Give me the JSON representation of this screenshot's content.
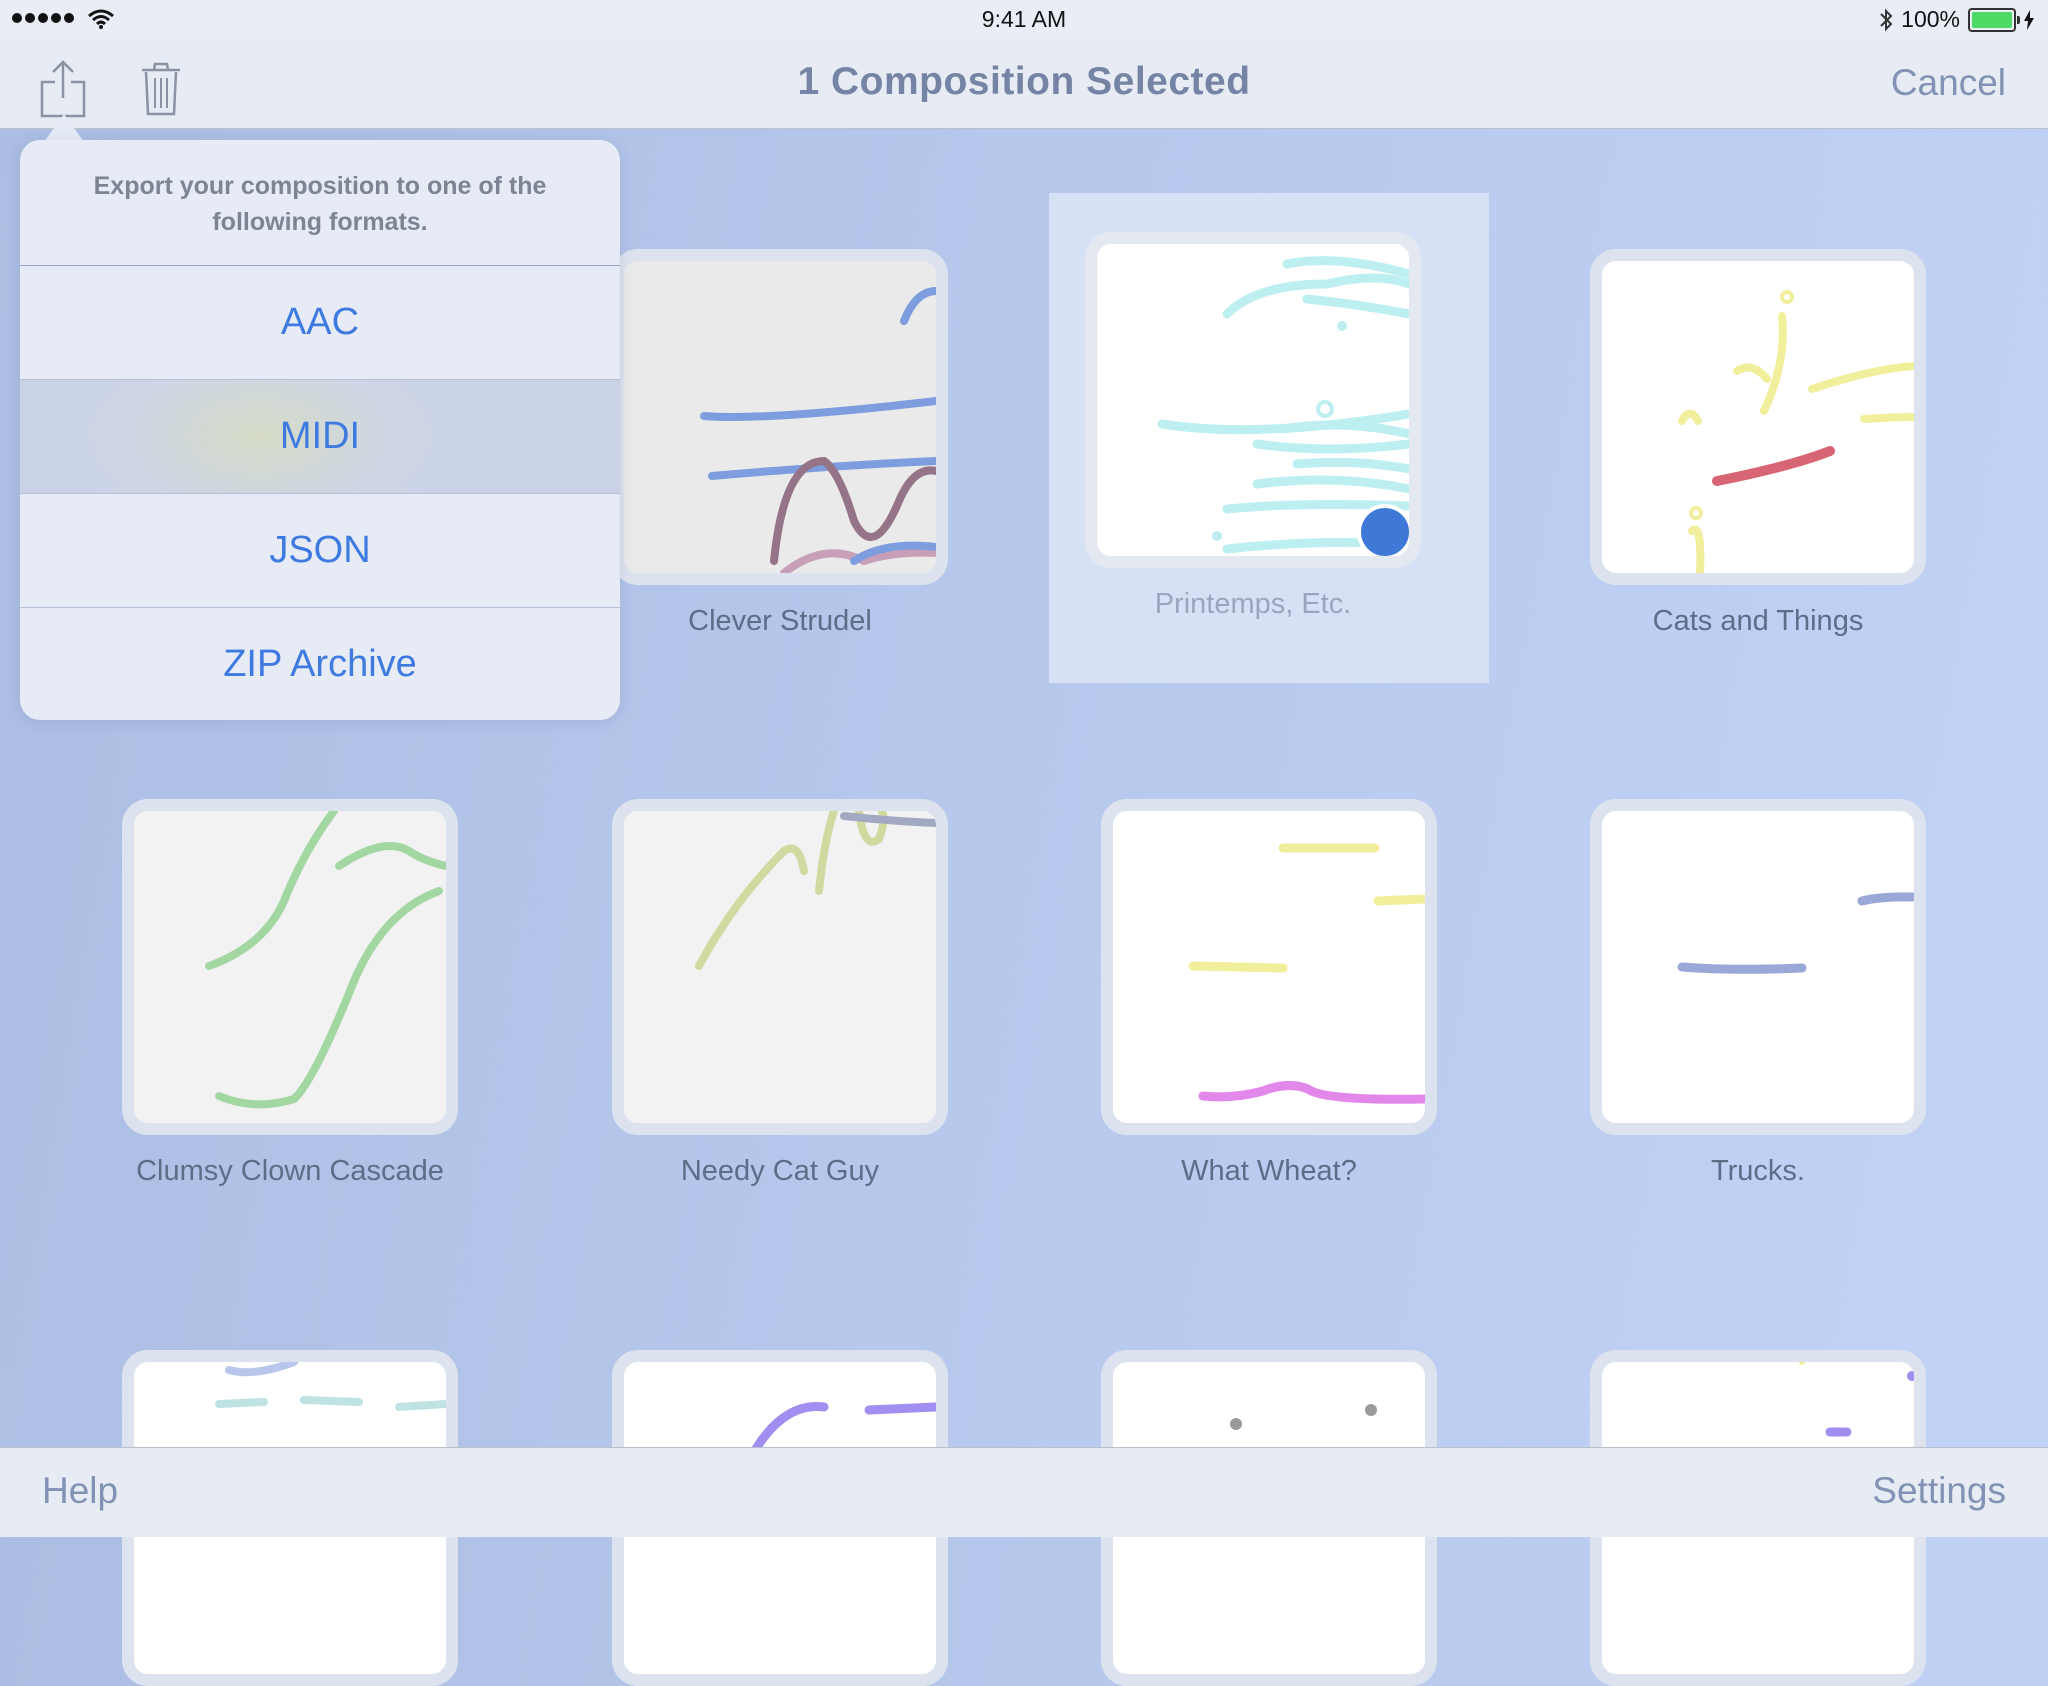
{
  "status_bar": {
    "time": "9:41 AM",
    "battery_text": "100%"
  },
  "nav": {
    "title": "1 Composition Selected",
    "cancel_label": "Cancel",
    "share_icon": "share-icon",
    "trash_icon": "trash-icon"
  },
  "popover": {
    "message": "Export your composition to one of the following formats.",
    "options": [
      "AAC",
      "MIDI",
      "JSON",
      "ZIP Archive"
    ],
    "highlighted": "MIDI"
  },
  "compositions": [
    {
      "title": "Clever Strudel",
      "selected": false
    },
    {
      "title": "Printemps, Etc.",
      "selected": true
    },
    {
      "title": "Cats and Things",
      "selected": false
    },
    {
      "title": "Clumsy Clown Cascade",
      "selected": false
    },
    {
      "title": "Needy Cat Guy",
      "selected": false
    },
    {
      "title": "What Wheat?",
      "selected": false
    },
    {
      "title": "Trucks.",
      "selected": false
    }
  ],
  "toolbar": {
    "help_label": "Help",
    "settings_label": "Settings"
  },
  "colors": {
    "accent": "#3f7ae0",
    "nav_text": "#8192b4",
    "title_text": "#7584a4",
    "check": "#3f79d8"
  }
}
